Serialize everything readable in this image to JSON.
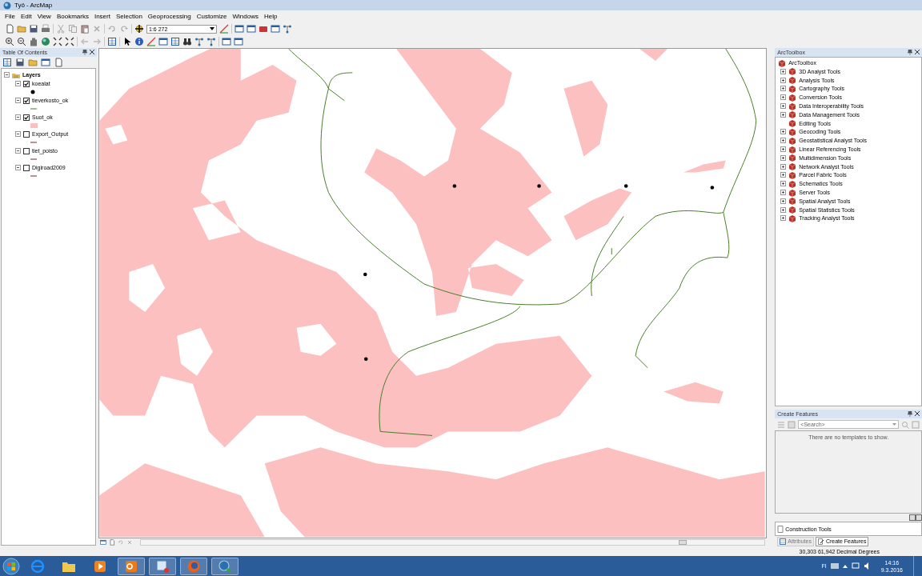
{
  "window": {
    "title": "Työ - ArcMap"
  },
  "menu": [
    "File",
    "Edit",
    "View",
    "Bookmarks",
    "Insert",
    "Selection",
    "Geoprocessing",
    "Customize",
    "Windows",
    "Help"
  ],
  "toolbar": {
    "scale": "1:6 272"
  },
  "table_of_contents": {
    "title": "Table Of Contents",
    "root": "Layers",
    "layers": [
      {
        "name": "koealat",
        "checked": true,
        "kind": "point"
      },
      {
        "name": "tieverkosto_ok",
        "checked": true,
        "kind": "line"
      },
      {
        "name": "Suot_ok",
        "checked": true,
        "kind": "polygon"
      },
      {
        "name": "Export_Output",
        "checked": false,
        "kind": "line"
      },
      {
        "name": "tiet_poisto",
        "checked": false,
        "kind": "line"
      },
      {
        "name": "Digiroad2009",
        "checked": false,
        "kind": "line"
      }
    ]
  },
  "arctoolbox": {
    "title": "ArcToolbox",
    "root": "ArcToolbox",
    "items": [
      {
        "label": "3D Analyst Tools",
        "expandable": true
      },
      {
        "label": "Analysis Tools",
        "expandable": true
      },
      {
        "label": "Cartography Tools",
        "expandable": true
      },
      {
        "label": "Conversion Tools",
        "expandable": true
      },
      {
        "label": "Data Interoperability Tools",
        "expandable": true
      },
      {
        "label": "Data Management Tools",
        "expandable": true
      },
      {
        "label": "Editing Tools",
        "expandable": false
      },
      {
        "label": "Geocoding Tools",
        "expandable": true
      },
      {
        "label": "Geostatistical Analyst Tools",
        "expandable": true
      },
      {
        "label": "Linear Referencing Tools",
        "expandable": true
      },
      {
        "label": "Multidimension Tools",
        "expandable": true
      },
      {
        "label": "Network Analyst Tools",
        "expandable": true
      },
      {
        "label": "Parcel Fabric Tools",
        "expandable": true
      },
      {
        "label": "Schematics Tools",
        "expandable": true
      },
      {
        "label": "Server Tools",
        "expandable": true
      },
      {
        "label": "Spatial Analyst Tools",
        "expandable": true
      },
      {
        "label": "Spatial Statistics Tools",
        "expandable": true
      },
      {
        "label": "Tracking Analyst Tools",
        "expandable": true
      }
    ]
  },
  "create_features": {
    "title": "Create Features",
    "search": {
      "placeholder": "<Search>"
    },
    "message": "There are no templates to show.",
    "construction_tools": "Construction Tools"
  },
  "tabs": [
    {
      "label": "Attributes",
      "selected": false
    },
    {
      "label": "Create Features",
      "selected": true
    }
  ],
  "status_bar": {
    "coordinates": "30,303  61,942 Decimal Degrees"
  },
  "taskbar": {
    "language": "FI",
    "time": "14:16",
    "date": "9.3.2016"
  }
}
